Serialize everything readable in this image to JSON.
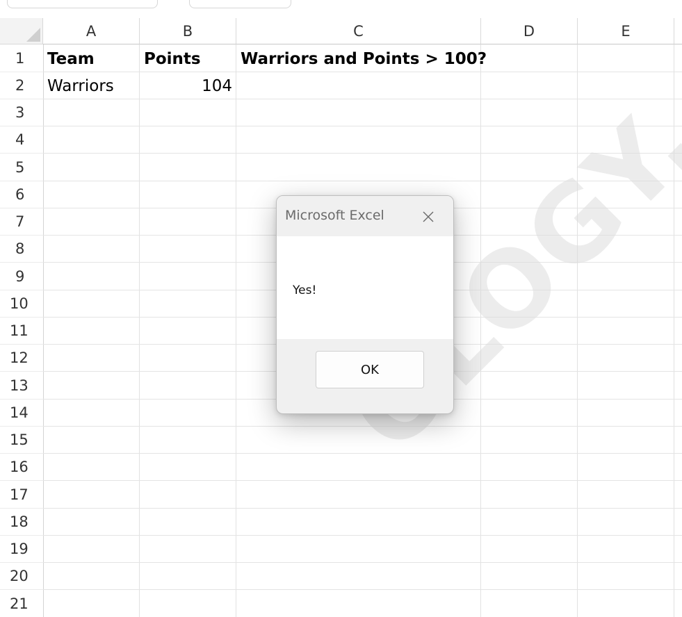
{
  "columns": [
    "A",
    "B",
    "C",
    "D",
    "E"
  ],
  "rows": [
    "1",
    "2",
    "3",
    "4",
    "5",
    "6",
    "7",
    "8",
    "9",
    "10",
    "11",
    "12",
    "13",
    "14",
    "15",
    "16",
    "17",
    "18",
    "19",
    "20",
    "21"
  ],
  "cells": {
    "A1": "Team",
    "B1": "Points",
    "C1": "Warriors and Points > 100?",
    "A2": "Warriors",
    "B2": "104"
  },
  "dialog": {
    "title": "Microsoft Excel",
    "message": "Yes!",
    "ok_label": "OK"
  },
  "watermark": "OLOGY."
}
